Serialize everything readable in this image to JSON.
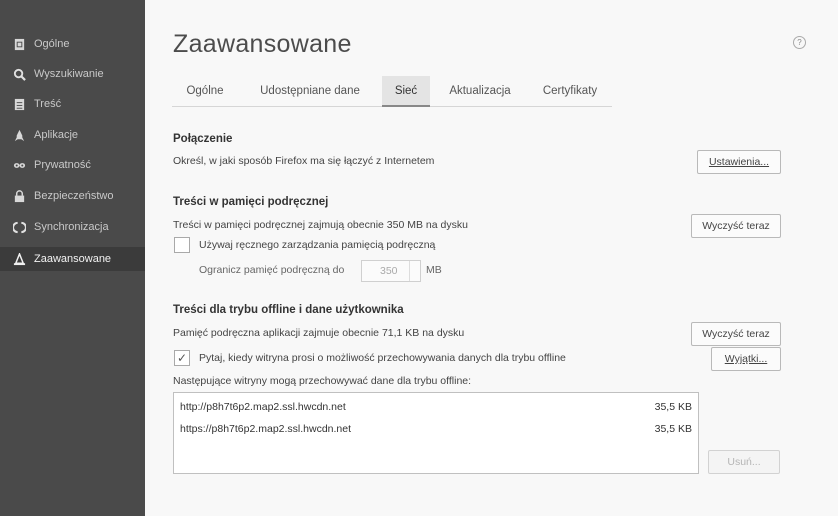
{
  "sidebar": {
    "items": [
      {
        "label": "Ogólne",
        "icon": "page-icon",
        "active": false
      },
      {
        "label": "Wyszukiwanie",
        "icon": "search-icon",
        "active": false
      },
      {
        "label": "Treść",
        "icon": "document-icon",
        "active": false
      },
      {
        "label": "Aplikacje",
        "icon": "rocket-icon",
        "active": false
      },
      {
        "label": "Prywatność",
        "icon": "mask-icon",
        "active": false
      },
      {
        "label": "Bezpieczeństwo",
        "icon": "lock-icon",
        "active": false
      },
      {
        "label": "Synchronizacja",
        "icon": "sync-icon",
        "active": false
      },
      {
        "label": "Zaawansowane",
        "icon": "wizard-hat-icon",
        "active": true
      }
    ]
  },
  "page": {
    "title": "Zaawansowane",
    "help": "?"
  },
  "tabs": [
    {
      "label": "Ogólne",
      "active": false
    },
    {
      "label": "Udostępniane dane",
      "active": false
    },
    {
      "label": "Sieć",
      "active": true
    },
    {
      "label": "Aktualizacja",
      "active": false
    },
    {
      "label": "Certyfikaty",
      "active": false
    }
  ],
  "connection": {
    "heading": "Połączenie",
    "desc": "Określ, w jaki sposób Firefox ma się łączyć z Internetem",
    "button": "Ustawienia..."
  },
  "cache": {
    "heading": "Treści w pamięci podręcznej",
    "desc": "Treści w pamięci podręcznej zajmują obecnie 350 MB na dysku",
    "button": "Wyczyść teraz",
    "override_label": "Używaj ręcznego zarządzania pamięcią podręczną",
    "override_checked": false,
    "limit_label": "Ogranicz pamięć podręczną do",
    "limit_value": "350",
    "limit_unit": "MB"
  },
  "offline": {
    "heading": "Treści dla trybu offline i dane użytkownika",
    "desc": "Pamięć podręczna aplikacji zajmuje obecnie 71,1 KB na dysku",
    "button": "Wyczyść teraz",
    "ask_label": "Pytaj, kiedy witryna prosi o możliwość przechowywania danych dla trybu offline",
    "ask_checked": true,
    "exceptions_button": "Wyjątki...",
    "list_label": "Następujące witryny mogą przechowywać dane dla trybu offline:",
    "sites": [
      {
        "site": "http://p8h7t6p2.map2.ssl.hwcdn.net",
        "size": "35,5 KB"
      },
      {
        "site": "https://p8h7t6p2.map2.ssl.hwcdn.net",
        "size": "35,5 KB"
      }
    ],
    "remove_button": "Usuń..."
  },
  "colors": {
    "sidebar_bg": "#4a4a4a",
    "sidebar_active_bg": "#3b3b3b",
    "content_bg": "#f8f8f8"
  }
}
